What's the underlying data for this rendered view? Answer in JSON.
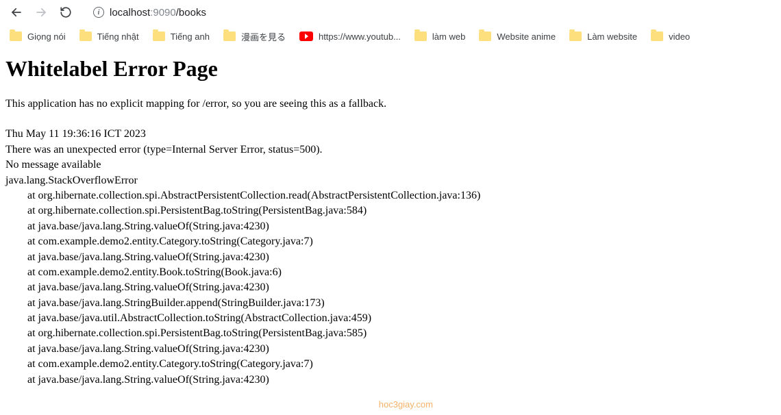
{
  "toolbar": {
    "url_host_dim": "localhost",
    "url_port_dim": ":9090",
    "url_path": "/books"
  },
  "bookmarks": [
    {
      "icon": "folder",
      "label": "Giọng nói"
    },
    {
      "icon": "folder",
      "label": "Tiếng nhật"
    },
    {
      "icon": "folder",
      "label": "Tiếng anh"
    },
    {
      "icon": "folder",
      "label": "漫画を見る"
    },
    {
      "icon": "youtube",
      "label": "https://www.youtub..."
    },
    {
      "icon": "folder",
      "label": "làm web"
    },
    {
      "icon": "folder",
      "label": "Website anime"
    },
    {
      "icon": "folder",
      "label": "Làm website"
    },
    {
      "icon": "folder",
      "label": "video"
    }
  ],
  "page": {
    "title": "Whitelabel Error Page",
    "fallback_msg": "This application has no explicit mapping for /error, so you are seeing this as a fallback.",
    "timestamp": "Thu May 11 19:36:16 ICT 2023",
    "error_line": "There was an unexpected error (type=Internal Server Error, status=500).",
    "message_line": "No message available",
    "exception": "java.lang.StackOverflowError",
    "stack": [
      "at org.hibernate.collection.spi.AbstractPersistentCollection.read(AbstractPersistentCollection.java:136)",
      "at org.hibernate.collection.spi.PersistentBag.toString(PersistentBag.java:584)",
      "at java.base/java.lang.String.valueOf(String.java:4230)",
      "at com.example.demo2.entity.Category.toString(Category.java:7)",
      "at java.base/java.lang.String.valueOf(String.java:4230)",
      "at com.example.demo2.entity.Book.toString(Book.java:6)",
      "at java.base/java.lang.String.valueOf(String.java:4230)",
      "at java.base/java.lang.StringBuilder.append(StringBuilder.java:173)",
      "at java.base/java.util.AbstractCollection.toString(AbstractCollection.java:459)",
      "at org.hibernate.collection.spi.PersistentBag.toString(PersistentBag.java:585)",
      "at java.base/java.lang.String.valueOf(String.java:4230)",
      "at com.example.demo2.entity.Category.toString(Category.java:7)",
      "at java.base/java.lang.String.valueOf(String.java:4230)"
    ]
  },
  "watermark": "hoc3giay.com"
}
